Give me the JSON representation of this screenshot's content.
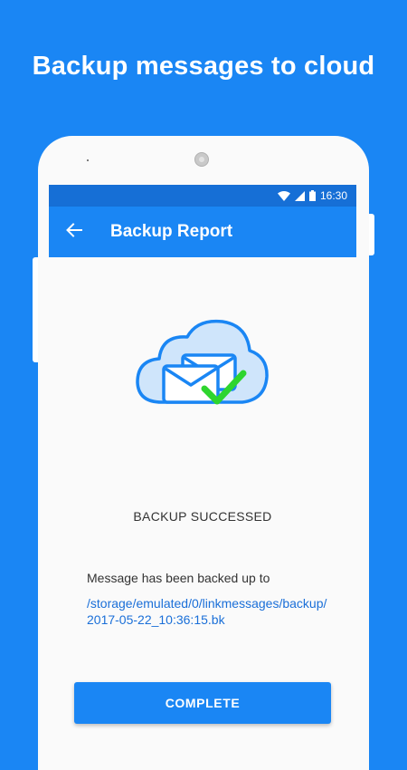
{
  "headline": "Backup messages to cloud",
  "status_bar": {
    "time": "16:30",
    "icons": [
      "wifi-icon",
      "signal-icon",
      "battery-icon"
    ]
  },
  "app_bar": {
    "back_icon": "arrow-back-icon",
    "title": "Backup Report"
  },
  "report": {
    "illustration": "cloud-envelope-check-icon",
    "status": "BACKUP SUCCESSED",
    "description": "Message has been backed up to",
    "path": "/storage/emulated/0/linkmessages/backup/2017-05-22_10:36:15.bk"
  },
  "actions": {
    "complete_label": "COMPLETE"
  },
  "colors": {
    "primary": "#1a86f4",
    "status_bar": "#166fd6",
    "link": "#1a6fd8",
    "check": "#2ed52e",
    "cloud_fill": "#cfe5fb"
  }
}
